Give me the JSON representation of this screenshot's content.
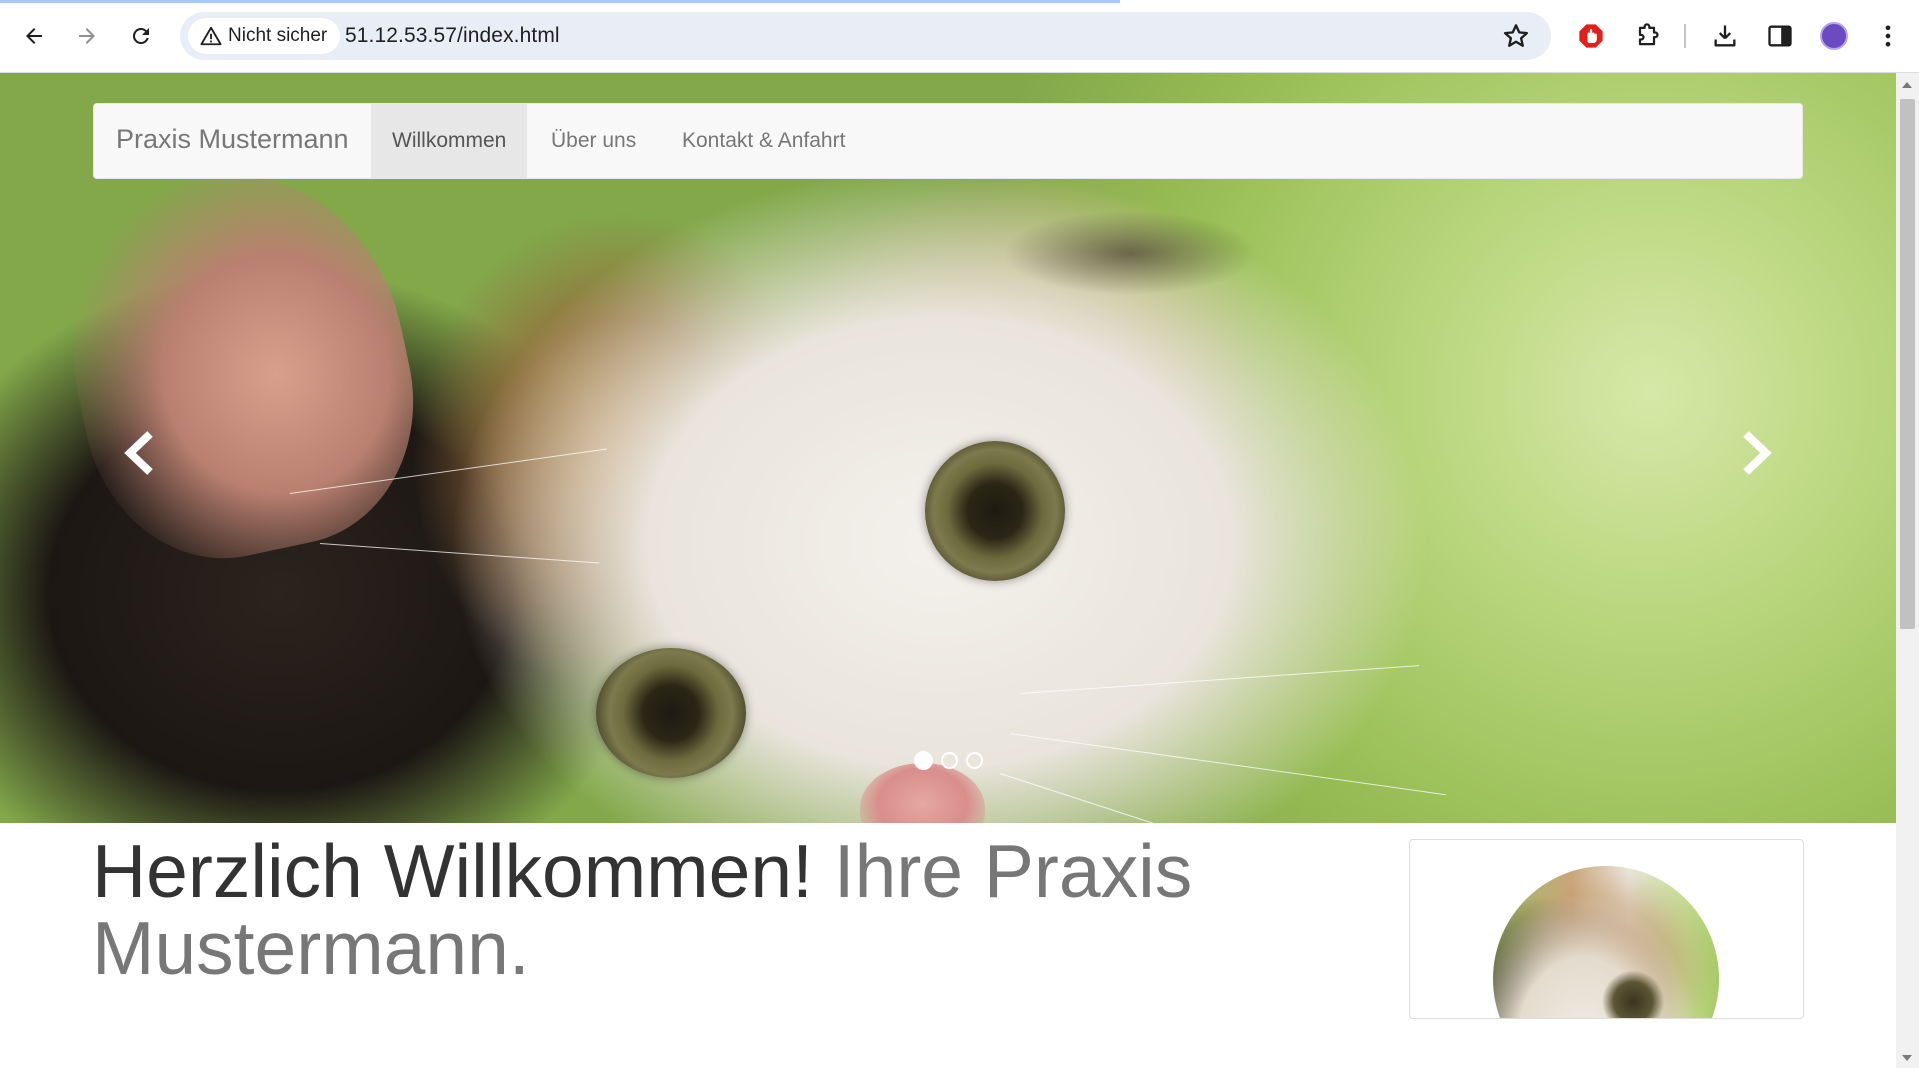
{
  "browser": {
    "security_chip": "Nicht sicher",
    "url": "51.12.53.57/index.html"
  },
  "navbar": {
    "brand": "Praxis Mustermann",
    "items": [
      {
        "label": "Willkommen",
        "active": true
      },
      {
        "label": "Über uns",
        "active": false
      },
      {
        "label": "Kontakt & Anfahrt",
        "active": false
      }
    ]
  },
  "carousel": {
    "slide_count": 3,
    "active_index": 0
  },
  "content": {
    "heading_main": "Herzlich Willkommen!",
    "heading_muted": "Ihre Praxis Mustermann."
  },
  "colors": {
    "navbar_bg": "#f8f8f8",
    "nav_active_bg": "#e7e7e7",
    "nav_text": "#777777",
    "heading_text": "#333333",
    "omnibox_bg": "#e9eef6"
  }
}
